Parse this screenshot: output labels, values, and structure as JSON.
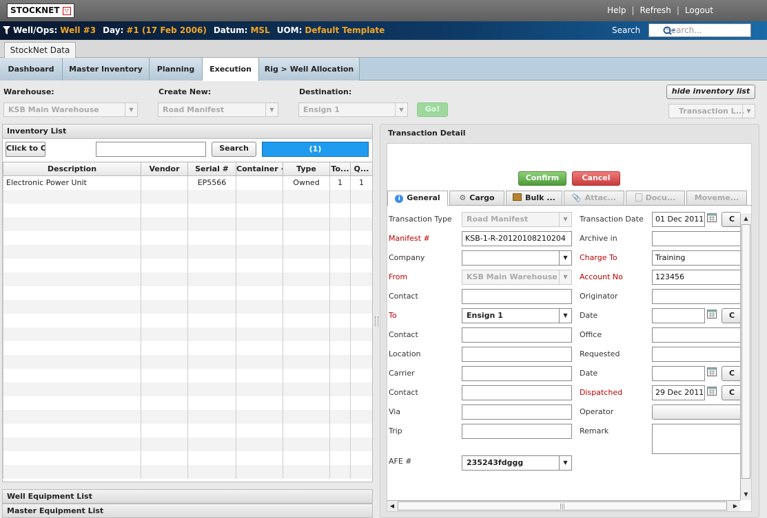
{
  "app": {
    "logo": "STOCKNET",
    "links": [
      "Help",
      "Refresh",
      "Logout"
    ]
  },
  "info": {
    "well_label": "Well/Ops:",
    "well": "Well #3",
    "day_label": "Day:",
    "day": "#1 (17 Feb 2006)",
    "datum_label": "Datum:",
    "datum": "MSL",
    "uom_label": "UOM:",
    "uom": "Default Template",
    "search_label": "Search",
    "search_placeholder": "Search..."
  },
  "app_tab": "StockNet Data",
  "nav": [
    "Dashboard",
    "Master Inventory",
    "Planning",
    "Execution",
    "Rig > Well Allocation"
  ],
  "toolbar": {
    "warehouse_label": "Warehouse:",
    "warehouse": "KSB Main Warehouse",
    "create_label": "Create New:",
    "create": "Road Manifest",
    "dest_label": "Destination:",
    "dest": "Ensign 1",
    "go": "Go!",
    "hide_btn": "hide inventory list",
    "trans_combo": "Transaction L..."
  },
  "inventory": {
    "title": "Inventory List",
    "click_btn": "Click to O",
    "search_btn": "Search",
    "count": "(1)",
    "columns": [
      "Description",
      "Vendor",
      "Serial #",
      "Container ·",
      "Type",
      "To...",
      "Q..."
    ],
    "rows": [
      [
        "Electronic Power Unit",
        "",
        "EP5566",
        "",
        "Owned",
        "1",
        "1"
      ]
    ]
  },
  "lists": {
    "well_eq": "Well Equipment List",
    "master_eq": "Master Equipment List"
  },
  "detail": {
    "title": "Transaction Detail",
    "confirm": "Confirm",
    "cancel": "Cancel",
    "tabs": [
      "General",
      "Cargo",
      "Bulk ...",
      "Attac...",
      "Docu...",
      "Moveme..."
    ],
    "left": [
      {
        "label": "Transaction Type",
        "value": "Road Manifest",
        "kind": "combo-dis",
        "req": false
      },
      {
        "label": "Manifest #",
        "value": "KSB-1-R-20120108210204",
        "kind": "input",
        "req": true
      },
      {
        "label": "Company",
        "value": "",
        "kind": "combo",
        "req": false
      },
      {
        "label": "From",
        "value": "KSB Main Warehouse",
        "kind": "combo-dis",
        "req": true
      },
      {
        "label": "Contact",
        "value": "",
        "kind": "input",
        "req": false
      },
      {
        "label": "To",
        "value": "Ensign 1",
        "kind": "combo",
        "req": true
      },
      {
        "label": "Contact",
        "value": "",
        "kind": "input",
        "req": false
      },
      {
        "label": "Location",
        "value": "",
        "kind": "input",
        "req": false
      },
      {
        "label": "Carrier",
        "value": "",
        "kind": "input",
        "req": false
      },
      {
        "label": "Contact",
        "value": "",
        "kind": "input",
        "req": false
      },
      {
        "label": "Via",
        "value": "",
        "kind": "input",
        "req": false
      },
      {
        "label": "Trip",
        "value": "",
        "kind": "input",
        "req": false
      }
    ],
    "afe_label": "AFE #",
    "afe": "235243fdggg",
    "right": [
      {
        "label": "Transaction Date",
        "value": "01 Dec 2011",
        "kind": "date",
        "req": false
      },
      {
        "label": "Archive in",
        "value": "",
        "kind": "input",
        "req": false
      },
      {
        "label": "Charge To",
        "value": "Training",
        "kind": "input",
        "req": true
      },
      {
        "label": "Account No",
        "value": "123456",
        "kind": "input",
        "req": true
      },
      {
        "label": "Originator",
        "value": "",
        "kind": "input",
        "req": false
      },
      {
        "label": "Date",
        "value": "",
        "kind": "date",
        "req": false
      },
      {
        "label": "Office",
        "value": "",
        "kind": "input",
        "req": false
      },
      {
        "label": "Requested",
        "value": "",
        "kind": "input",
        "req": false
      },
      {
        "label": "Date",
        "value": "",
        "kind": "date",
        "req": false
      },
      {
        "label": "Dispatched",
        "value": "29 Dec 2011",
        "kind": "date",
        "req": true
      },
      {
        "label": "Operator",
        "value": "",
        "kind": "button",
        "req": false
      },
      {
        "label": "Remark",
        "value": "",
        "kind": "textarea",
        "req": false
      }
    ],
    "small_btn": "C"
  }
}
